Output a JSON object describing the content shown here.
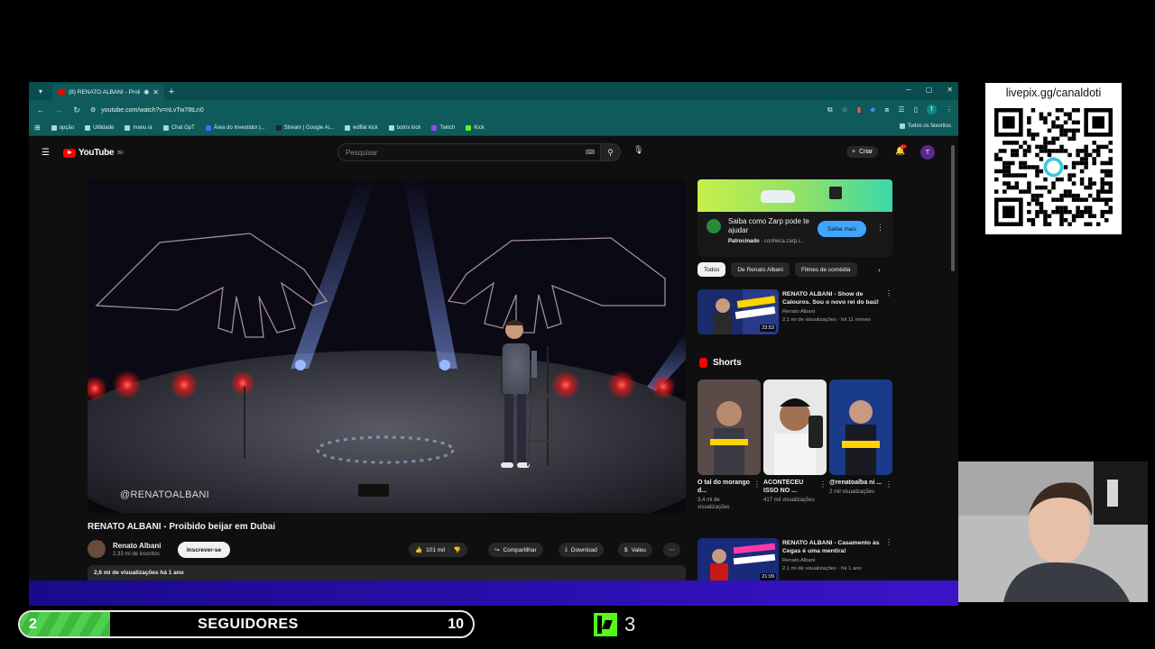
{
  "browser": {
    "tab_title": "(8) RENATO ALBANI - Proib...",
    "url": "youtube.com/watch?v=nLvTw78tLn0",
    "bookmarks": [
      "opção",
      "Utilidade",
      "manu ia",
      "Chat GpT",
      "Área do Investidor |...",
      "Stream | Google Al...",
      "wdflat kick",
      "botrix kick",
      "Twitch",
      "Kick"
    ],
    "all_bookmarks": "Todos os favoritos",
    "avatar_letter": "T"
  },
  "youtube": {
    "logo_text": "YouTube",
    "logo_region": "BR",
    "search_placeholder": "Pesquisar",
    "create_label": "Criar",
    "notif_badge": "9+",
    "avatar_letter": "T"
  },
  "video": {
    "watermark": "@RENATOALBANI",
    "title": "RENATO ALBANI - Proibido beijar em Dubai",
    "channel": "Renato Albani",
    "subscribers": "2,33 mi de inscritos",
    "subscribe_label": "Inscrever-se",
    "likes": "101 mil",
    "share_label": "Compartilhar",
    "download_label": "Download",
    "thanks_label": "Valeu",
    "views_line": "2,6 mi de visualizações  há 1 ano"
  },
  "sidebar": {
    "ad": {
      "title": "Saiba como Zarp pode te ajudar",
      "sponsored": "Patrocinado",
      "domain": "· conheca.zarp.i...",
      "cta": "Saiba mais"
    },
    "chips": [
      {
        "label": "Todos",
        "active": true
      },
      {
        "label": "De Renato Albani",
        "active": false
      },
      {
        "label": "Filmes de comédia",
        "active": false
      }
    ],
    "recommendations": [
      {
        "title": "RENATO ALBANI - Show de Calouros. Sou o novo rei do baú!",
        "channel": "Renato Albani",
        "meta": "2,1 mi de visualizações · há 11 meses",
        "duration": "23:53"
      },
      {
        "title": "RENATO ALBANI - Casamento às Cegas é uma mentira!",
        "channel": "Renato Albani",
        "meta": "2,1 mi de visualizações · há 1 ano",
        "duration": "21:09"
      }
    ],
    "shorts_heading": "Shorts",
    "shorts": [
      {
        "title": "O tal do morango d...",
        "views": "3,4 mi de visualizações"
      },
      {
        "title": "ACONTECEU ISSO NO ...",
        "views": "417 mil visualizações"
      },
      {
        "title": "@renatoalba ni ...",
        "views": "2 mil visualizações"
      }
    ]
  },
  "overlay": {
    "qr_label": "livepix.gg/canaldoti",
    "followers_label": "SEGUIDORES",
    "followers_current": "2",
    "followers_goal": "10",
    "followers_progress": 0.2,
    "kick_count": "3"
  },
  "colors": {
    "browser_chrome": "#0f5a5a",
    "yt_bg": "#0f0f0f",
    "yt_red": "#ff0000",
    "ad_cta": "#3ea6ff",
    "kick_green": "#53fc18",
    "overlay_purple": "#2b0fb0"
  }
}
